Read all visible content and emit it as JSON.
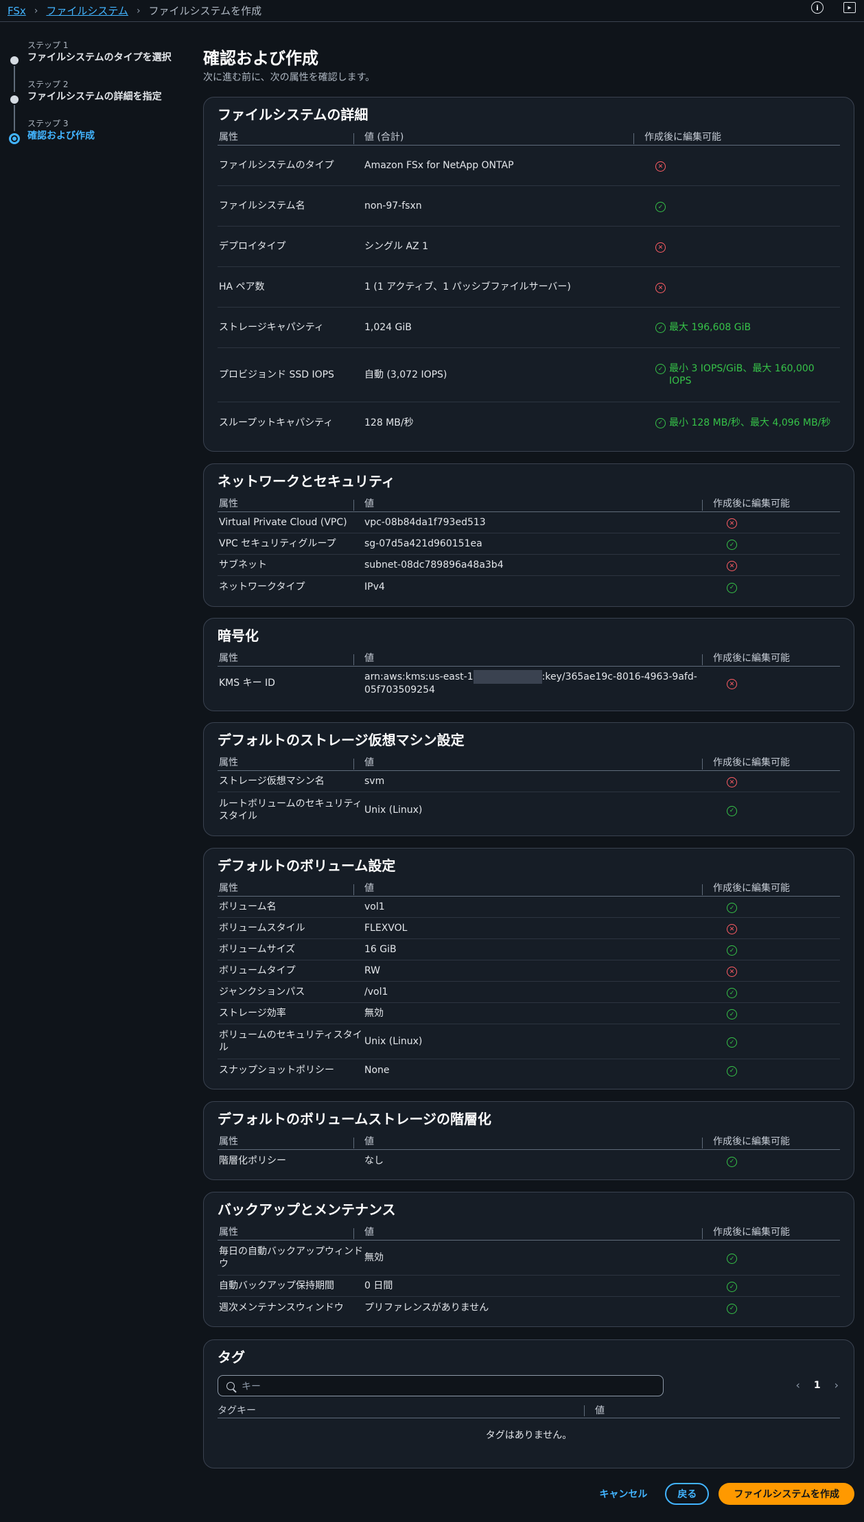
{
  "breadcrumb": {
    "root": "FSx",
    "parent": "ファイルシステム",
    "current": "ファイルシステムを作成"
  },
  "steps": [
    {
      "num": "ステップ 1",
      "name": "ファイルシステムのタイプを選択"
    },
    {
      "num": "ステップ 2",
      "name": "ファイルシステムの詳細を指定"
    },
    {
      "num": "ステップ 3",
      "name": "確認および作成"
    }
  ],
  "page": {
    "title": "確認および作成",
    "description": "次に進む前に、次の属性を確認します。"
  },
  "details": {
    "title": "ファイルシステムの詳細",
    "headers": [
      "属性",
      "値 (合計)",
      "作成後に編集可能"
    ],
    "rows": [
      {
        "attr": "ファイルシステムのタイプ",
        "value": "Amazon FSx for NetApp ONTAP",
        "editable": false,
        "note": ""
      },
      {
        "attr": "ファイルシステム名",
        "value": "non-97-fsxn",
        "editable": true,
        "note": ""
      },
      {
        "attr": "デプロイタイプ",
        "value": "シングル AZ 1",
        "editable": false,
        "note": ""
      },
      {
        "attr": "HA ペア数",
        "value": "1 (1 アクティブ、1 パッシブファイルサーバー)",
        "editable": false,
        "note": ""
      },
      {
        "attr": "ストレージキャパシティ",
        "value": "1,024 GiB",
        "editable": true,
        "note": "最大 196,608 GiB"
      },
      {
        "attr": "プロビジョンド SSD IOPS",
        "value": "自動 (3,072 IOPS)",
        "editable": true,
        "note": "最小 3 IOPS/GiB、最大 160,000 IOPS"
      },
      {
        "attr": "スループットキャパシティ",
        "value": "128 MB/秒",
        "editable": true,
        "note": "最小 128 MB/秒、最大 4,096 MB/秒"
      }
    ]
  },
  "network": {
    "title": "ネットワークとセキュリティ",
    "headers": [
      "属性",
      "値",
      "作成後に編集可能"
    ],
    "rows": [
      {
        "attr": "Virtual Private Cloud (VPC)",
        "value": "vpc-08b84da1f793ed513",
        "editable": false
      },
      {
        "attr": "VPC セキュリティグループ",
        "value": "sg-07d5a421d960151ea",
        "editable": true
      },
      {
        "attr": "サブネット",
        "value": "subnet-08dc789896a48a3b4",
        "editable": false
      },
      {
        "attr": "ネットワークタイプ",
        "value": "IPv4",
        "editable": true
      }
    ]
  },
  "encryption": {
    "title": "暗号化",
    "headers": [
      "属性",
      "値",
      "作成後に編集可能"
    ],
    "rows": [
      {
        "attr": "KMS キー ID",
        "value_prefix": "arn:aws:kms:us-east-1",
        "value_suffix": ":key/365ae19c-8016-4963-9afd-05f703509254",
        "editable": false
      }
    ]
  },
  "svm": {
    "title": "デフォルトのストレージ仮想マシン設定",
    "headers": [
      "属性",
      "値",
      "作成後に編集可能"
    ],
    "rows": [
      {
        "attr": "ストレージ仮想マシン名",
        "value": "svm",
        "editable": false
      },
      {
        "attr": "ルートボリュームのセキュリティスタイル",
        "value": "Unix (Linux)",
        "editable": true
      }
    ]
  },
  "volume": {
    "title": "デフォルトのボリューム設定",
    "headers": [
      "属性",
      "値",
      "作成後に編集可能"
    ],
    "rows": [
      {
        "attr": "ボリューム名",
        "value": "vol1",
        "editable": true
      },
      {
        "attr": "ボリュームスタイル",
        "value": "FLEXVOL",
        "editable": false
      },
      {
        "attr": "ボリュームサイズ",
        "value": "16 GiB",
        "editable": true
      },
      {
        "attr": "ボリュームタイプ",
        "value": "RW",
        "editable": false
      },
      {
        "attr": "ジャンクションパス",
        "value": "/vol1",
        "editable": true
      },
      {
        "attr": "ストレージ効率",
        "value": "無効",
        "editable": true
      },
      {
        "attr": "ボリュームのセキュリティスタイル",
        "value": "Unix (Linux)",
        "editable": true
      },
      {
        "attr": "スナップショットポリシー",
        "value": "None",
        "editable": true
      }
    ]
  },
  "tiering": {
    "title": "デフォルトのボリュームストレージの階層化",
    "headers": [
      "属性",
      "値",
      "作成後に編集可能"
    ],
    "rows": [
      {
        "attr": "階層化ポリシー",
        "value": "なし",
        "editable": true
      }
    ]
  },
  "backup": {
    "title": "バックアップとメンテナンス",
    "headers": [
      "属性",
      "値",
      "作成後に編集可能"
    ],
    "rows": [
      {
        "attr": "毎日の自動バックアップウィンドウ",
        "value": "無効",
        "editable": true
      },
      {
        "attr": "自動バックアップ保持期間",
        "value": "0 日間",
        "editable": true
      },
      {
        "attr": "週次メンテナンスウィンドウ",
        "value": "プリファレンスがありません",
        "editable": true
      }
    ]
  },
  "tags": {
    "title": "タグ",
    "search_placeholder": "キー",
    "page": "1",
    "headers": [
      "タグキー",
      "値"
    ],
    "empty": "タグはありません。"
  },
  "actions": {
    "cancel": "キャンセル",
    "back": "戻る",
    "create": "ファイルシステムを作成"
  },
  "colors": {
    "accent": "#42b4ff",
    "ok": "#36c248",
    "ng": "#ff5d64",
    "primary": "#ff9900"
  }
}
